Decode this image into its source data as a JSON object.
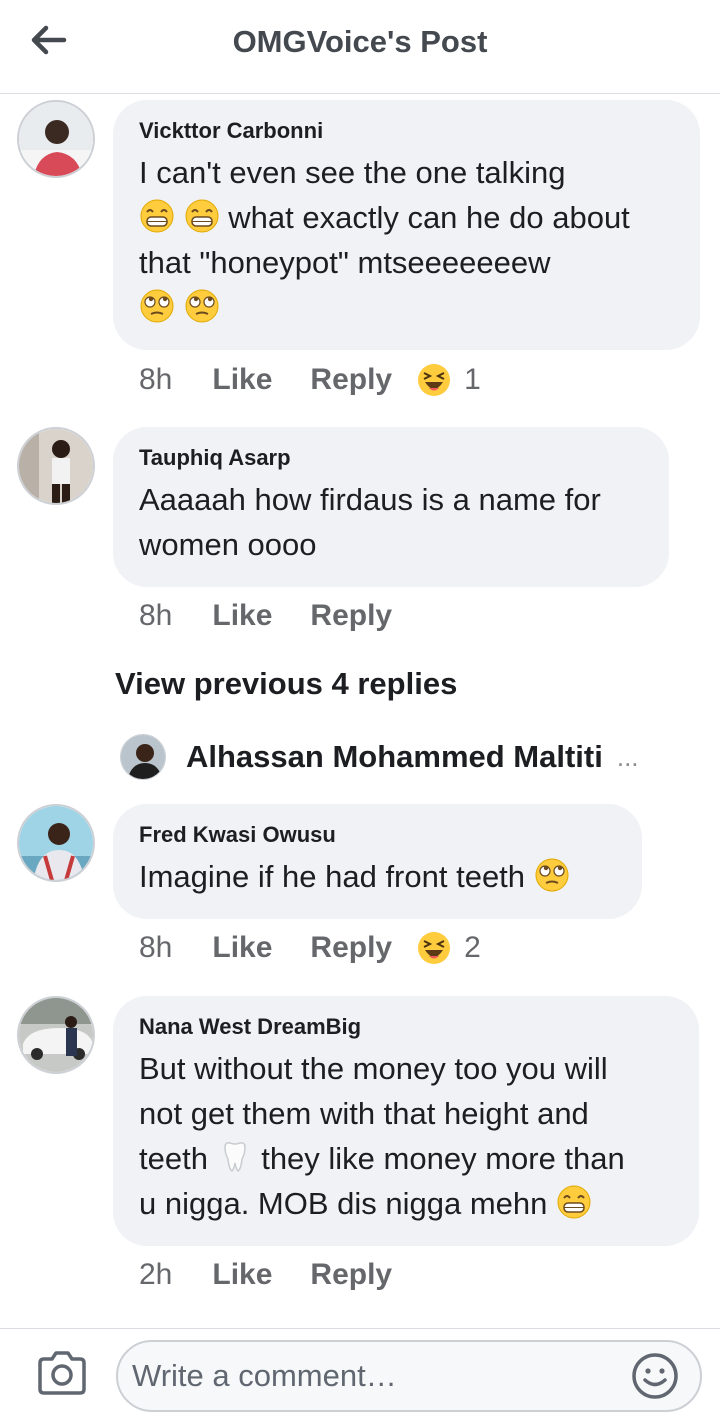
{
  "header": {
    "title": "OMGVoice's Post",
    "back_icon": "arrow-left-icon"
  },
  "comments": [
    {
      "author": "Vickttor Carbonni",
      "lines": [
        "I can't even see the one talking",
        "what exactly can he do about",
        "that \"honeypot\" mtseeeeeeew"
      ],
      "time": "8h",
      "like": "Like",
      "reply": "Reply",
      "reaction": "laughing",
      "reaction_count": "1"
    },
    {
      "author": "Tauphiq Asarp",
      "lines": [
        "Aaaaah how firdaus is a name for",
        "women oooo"
      ],
      "time": "8h",
      "like": "Like",
      "reply": "Reply"
    },
    {
      "author": "Fred Kwasi Owusu",
      "lines": [
        "Imagine if he had front teeth"
      ],
      "time": "8h",
      "like": "Like",
      "reply": "Reply",
      "reaction": "laughing",
      "reaction_count": "2"
    },
    {
      "author": "Nana West DreamBig",
      "lines": [
        "But without the money too you will",
        "not get them with that height and",
        "teeth",
        "they like money more than",
        "u nigga. MOB dis nigga mehn"
      ],
      "time": "2h",
      "like": "Like",
      "reply": "Reply"
    }
  ],
  "replies_thread": {
    "view_previous": "View previous 4 replies",
    "last_reply_author": "Alhassan Mohammed Maltiti",
    "more": "..."
  },
  "composer": {
    "placeholder": "Write a comment…",
    "camera_icon": "camera-icon",
    "emoji_icon": "smiley-icon"
  },
  "colors": {
    "bubble": "#f0f2f5",
    "meta_text": "#65676b",
    "text": "#1c1e21"
  }
}
